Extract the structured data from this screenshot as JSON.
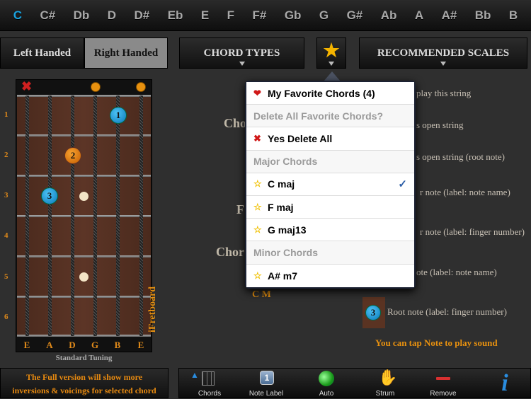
{
  "keys": [
    "C",
    "C#",
    "Db",
    "D",
    "D#",
    "Eb",
    "E",
    "F",
    "F#",
    "Gb",
    "G",
    "G#",
    "Ab",
    "A",
    "A#",
    "Bb",
    "B"
  ],
  "selected_key": "C",
  "hand": {
    "left": "Left Handed",
    "right": "Right Handed",
    "selected": "Right Handed"
  },
  "chord_types": "CHORD TYPES",
  "scales": "RECOMMENDED SCALES",
  "fret_numbers": [
    "1",
    "2",
    "3",
    "4",
    "5",
    "6"
  ],
  "strings": [
    "E",
    "A",
    "D",
    "G",
    "B",
    "E"
  ],
  "fingers": [
    "1",
    "2",
    "3"
  ],
  "tuning": "Standard Tuning",
  "brand": "iFretboard",
  "popover": {
    "title": "My Favorite Chords (4)",
    "delete_prompt": "Delete All Favorite Chords?",
    "delete_confirm": "Yes Delete All",
    "major_header": "Major Chords",
    "major": [
      "C maj",
      "F maj",
      "G maj13"
    ],
    "minor_header": "Minor Chords",
    "minor": [
      "A# m7"
    ],
    "checked": "C maj"
  },
  "background_left": [
    "Cho",
    "F",
    "Chor",
    "C M"
  ],
  "legend": [
    "play this string",
    "s open string",
    "s open string (root note)",
    "r note (label: note name)",
    "r note (label: finger number)",
    "ote (label: note name)",
    "Root note (label: finger number)"
  ],
  "legend_finger": "3",
  "tip": "You can tap Note to play sound",
  "full_version": [
    "The Full version will show more",
    "inversions & voicings for selected chord"
  ],
  "toolbar": [
    "Chords",
    "Note Label",
    "Auto",
    "Strum",
    "Remove"
  ],
  "note_label_num": "1",
  "colors": {
    "accent_blue": "#1aa3e0",
    "orange": "#e88a10"
  }
}
